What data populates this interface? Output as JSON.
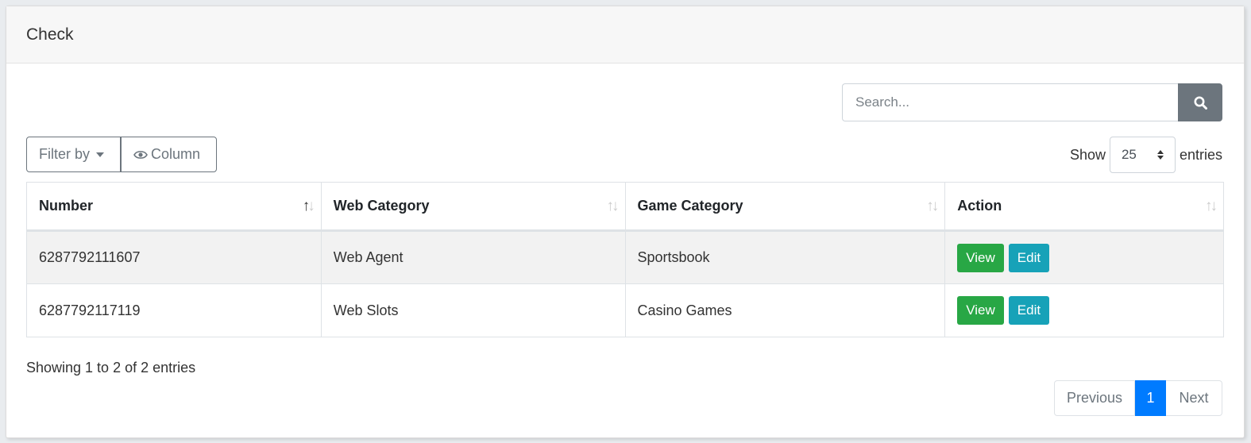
{
  "card": {
    "title": "Check"
  },
  "search": {
    "placeholder": "Search...",
    "icon": "search-icon"
  },
  "toolbar": {
    "filter_label": "Filter by",
    "column_label": "Column",
    "column_icon": "eye-icon"
  },
  "entries": {
    "show_label": "Show",
    "value": "25",
    "suffix": "entries"
  },
  "table": {
    "columns": [
      {
        "label": "Number",
        "sort": "asc"
      },
      {
        "label": "Web Category",
        "sort": "none"
      },
      {
        "label": "Game Category",
        "sort": "none"
      },
      {
        "label": "Action",
        "sort": "none"
      }
    ],
    "rows": [
      {
        "number": "6287792111607",
        "web_category": "Web Agent",
        "game_category": "Sportsbook",
        "view": "View",
        "edit": "Edit"
      },
      {
        "number": "6287792117119",
        "web_category": "Web Slots",
        "game_category": "Casino Games",
        "view": "View",
        "edit": "Edit"
      }
    ]
  },
  "info": "Showing 1 to 2 of 2 entries",
  "pagination": {
    "previous": "Previous",
    "current": "1",
    "next": "Next"
  },
  "colors": {
    "view": "#28a745",
    "edit": "#17a2b8",
    "page_active": "#007bff",
    "search_button": "#6c757d"
  }
}
